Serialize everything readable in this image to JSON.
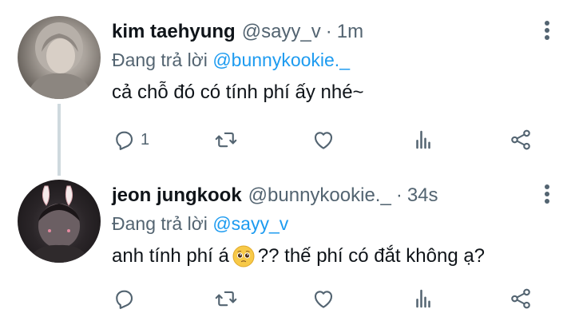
{
  "tweets": [
    {
      "display_name": "kim taehyung",
      "handle": "@sayy_v",
      "separator": "·",
      "time": "1m",
      "reply_prefix": "Đang trả lời",
      "reply_to": "@bunnykookie._",
      "text": "cả chỗ đó có tính phí ấy nhé~",
      "reply_count": "1"
    },
    {
      "display_name": "jeon jungkook",
      "handle": "@bunnykookie._",
      "separator": "·",
      "time": "34s",
      "reply_prefix": "Đang trả lời",
      "reply_to": "@sayy_v",
      "text_before_emoji": "anh tính phí á",
      "emoji": "pleading-face",
      "text_after_emoji": "?? thế phí có đắt không ạ?",
      "reply_count": ""
    }
  ],
  "colors": {
    "accent": "#1d9bf0",
    "secondary_text": "#536471",
    "primary_text": "#0f1419",
    "thread_line": "#cfd9de"
  },
  "icons": [
    "reply-icon",
    "retweet-icon",
    "like-icon",
    "stats-icon",
    "share-icon",
    "more-icon"
  ]
}
